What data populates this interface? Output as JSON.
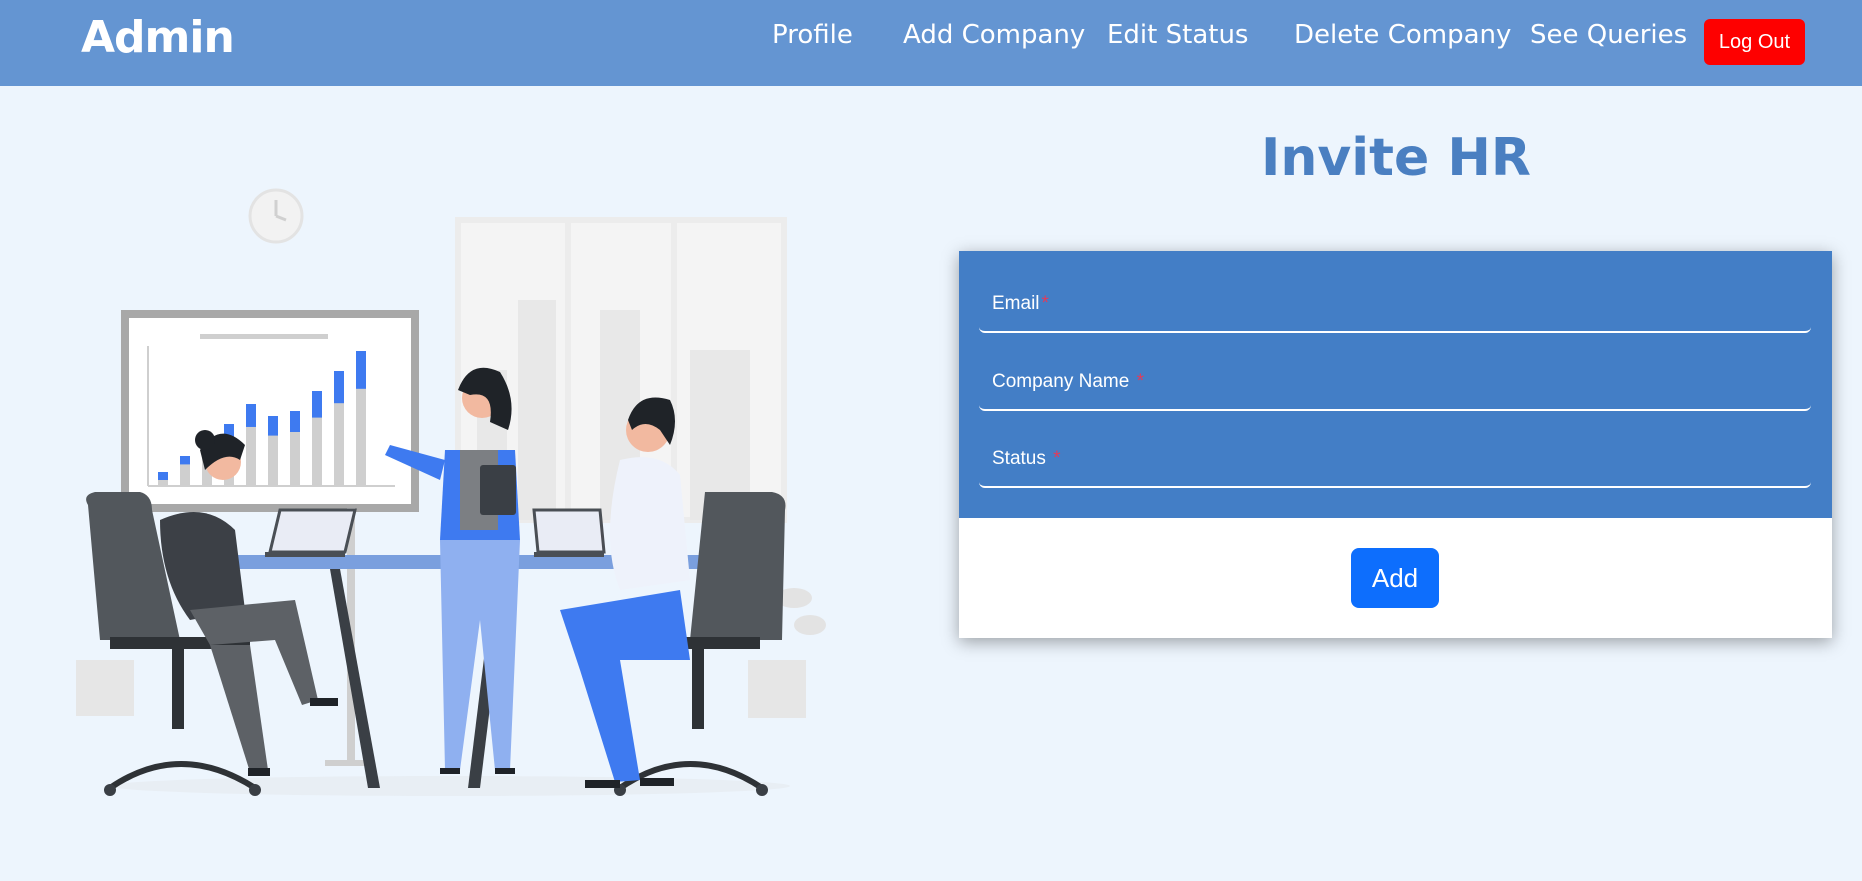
{
  "navbar": {
    "brand": "Admin",
    "links": [
      "Profile",
      "Add Company",
      "Edit Status",
      "Delete Company",
      "See Queries"
    ],
    "logout_label": "Log Out",
    "background": "#6495d2",
    "logout_color": "#fe0000"
  },
  "main": {
    "title": "Invite HR",
    "form": {
      "fields": [
        {
          "label": "Email",
          "required_mark": "*",
          "value": ""
        },
        {
          "label": "Company Name ",
          "required_mark": "*",
          "value": ""
        },
        {
          "label": "Status ",
          "required_mark": "*",
          "value": ""
        }
      ],
      "submit_label": "Add"
    },
    "colors": {
      "form_bg": "#437ec6",
      "title": "#4a7fc1",
      "button": "#0d6efd",
      "page_bg": "#edf5fd"
    }
  },
  "illustration": {
    "icons": [
      "clock-icon",
      "presentation-board",
      "chair-icon",
      "laptop-icon",
      "plant-icon"
    ]
  }
}
